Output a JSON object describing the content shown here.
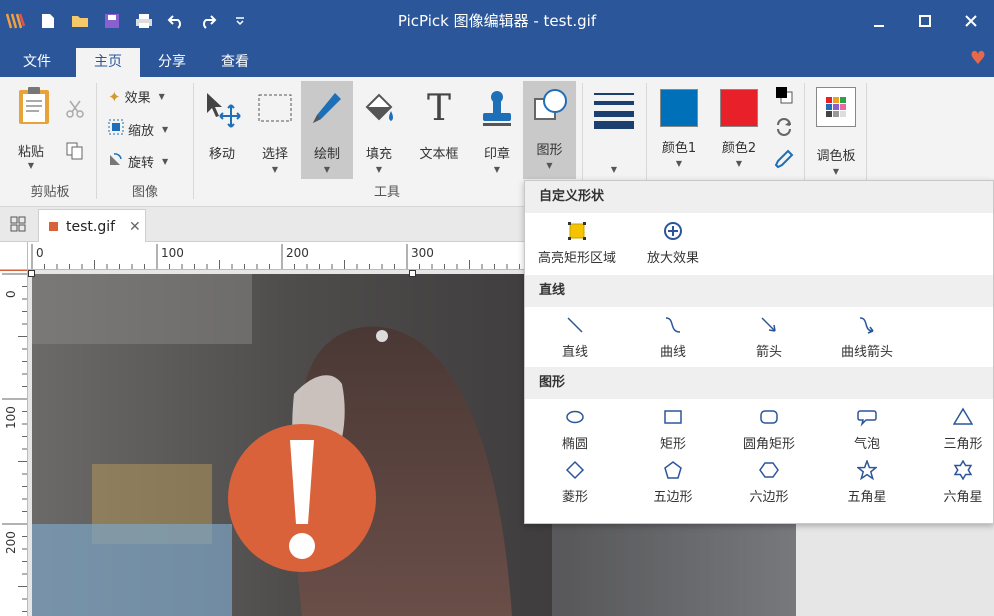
{
  "window": {
    "title": "PicPick 图像编辑器 - test.gif"
  },
  "quick_access": [
    "picpick-logo-icon",
    "new-file-icon",
    "open-folder-icon",
    "save-icon",
    "print-icon",
    "undo-icon",
    "redo-icon",
    "customize-icon"
  ],
  "tabs": [
    "文件",
    "主页",
    "分享",
    "查看"
  ],
  "ribbon": {
    "paste": "粘贴",
    "clipboard_group": "剪贴板",
    "effects": "效果",
    "resize": "缩放",
    "rotate": "旋转",
    "image_group": "图像",
    "move": "移动",
    "select": "选择",
    "draw": "绘制",
    "fill": "填充",
    "textbox": "文本框",
    "stamp": "印章",
    "shapes": "图形",
    "tools_group": "工具",
    "color1": "颜色1",
    "color2": "颜色2",
    "palette": "调色板"
  },
  "colors": {
    "primary": "#0070b8",
    "secondary": "#e8202a",
    "accent": "#2b579a",
    "warning": "#d9623b"
  },
  "document_tab": {
    "name": "test.gif"
  },
  "ruler": {
    "top_ticks": [
      "0",
      "100",
      "200",
      "300"
    ],
    "left_ticks": [
      "0",
      "100",
      "200"
    ]
  },
  "shapes_menu": {
    "custom_title": "自定义形状",
    "custom": [
      "高亮矩形区域",
      "放大效果"
    ],
    "lines_title": "直线",
    "lines": [
      "直线",
      "曲线",
      "箭头",
      "曲线箭头"
    ],
    "shapes_title": "图形",
    "shapes_row1": [
      "椭圆",
      "矩形",
      "圆角矩形",
      "气泡",
      "三角形"
    ],
    "shapes_row2": [
      "菱形",
      "五边形",
      "六边形",
      "五角星",
      "六角星"
    ]
  },
  "canvas": {
    "warning_symbol": "!"
  }
}
